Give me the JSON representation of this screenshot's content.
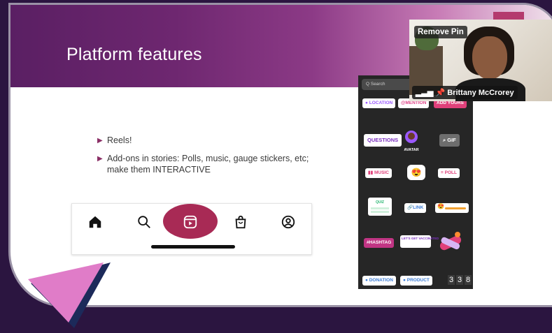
{
  "slide": {
    "title": "Platform features",
    "bullets": [
      "Reels!",
      "Add-ons in stories: Polls, music, gauge stickers, etc; make them INTERACTIVE"
    ]
  },
  "instagram_nav": {
    "icons": [
      "home-icon",
      "search-icon",
      "reels-icon",
      "shop-icon",
      "profile-icon"
    ],
    "highlight_color": "#a82a55"
  },
  "stickers_panel": {
    "search_placeholder": "Q Search",
    "stickers": [
      "LOCATION",
      "@MENTION",
      "ADD YOURS",
      "QUESTIONS",
      "AVATAR",
      "GIF",
      "MUSIC",
      "POLL",
      "QUIZ",
      "LINK",
      "#HASHTAG",
      "LET'S GET VACCINATED",
      "DONATION",
      "PRODUCT"
    ],
    "timer_digits": [
      "3",
      "3",
      "8"
    ]
  },
  "webcam": {
    "remove_pin_label": "Remove Pin",
    "participant_name": "Brittany McCrorey"
  },
  "colors": {
    "frame": "#2b1540",
    "title_gradient_start": "#5a1f63",
    "accent": "#b43a6e",
    "triangle_pink": "#e07cc8",
    "triangle_navy": "#1c2a5a"
  }
}
